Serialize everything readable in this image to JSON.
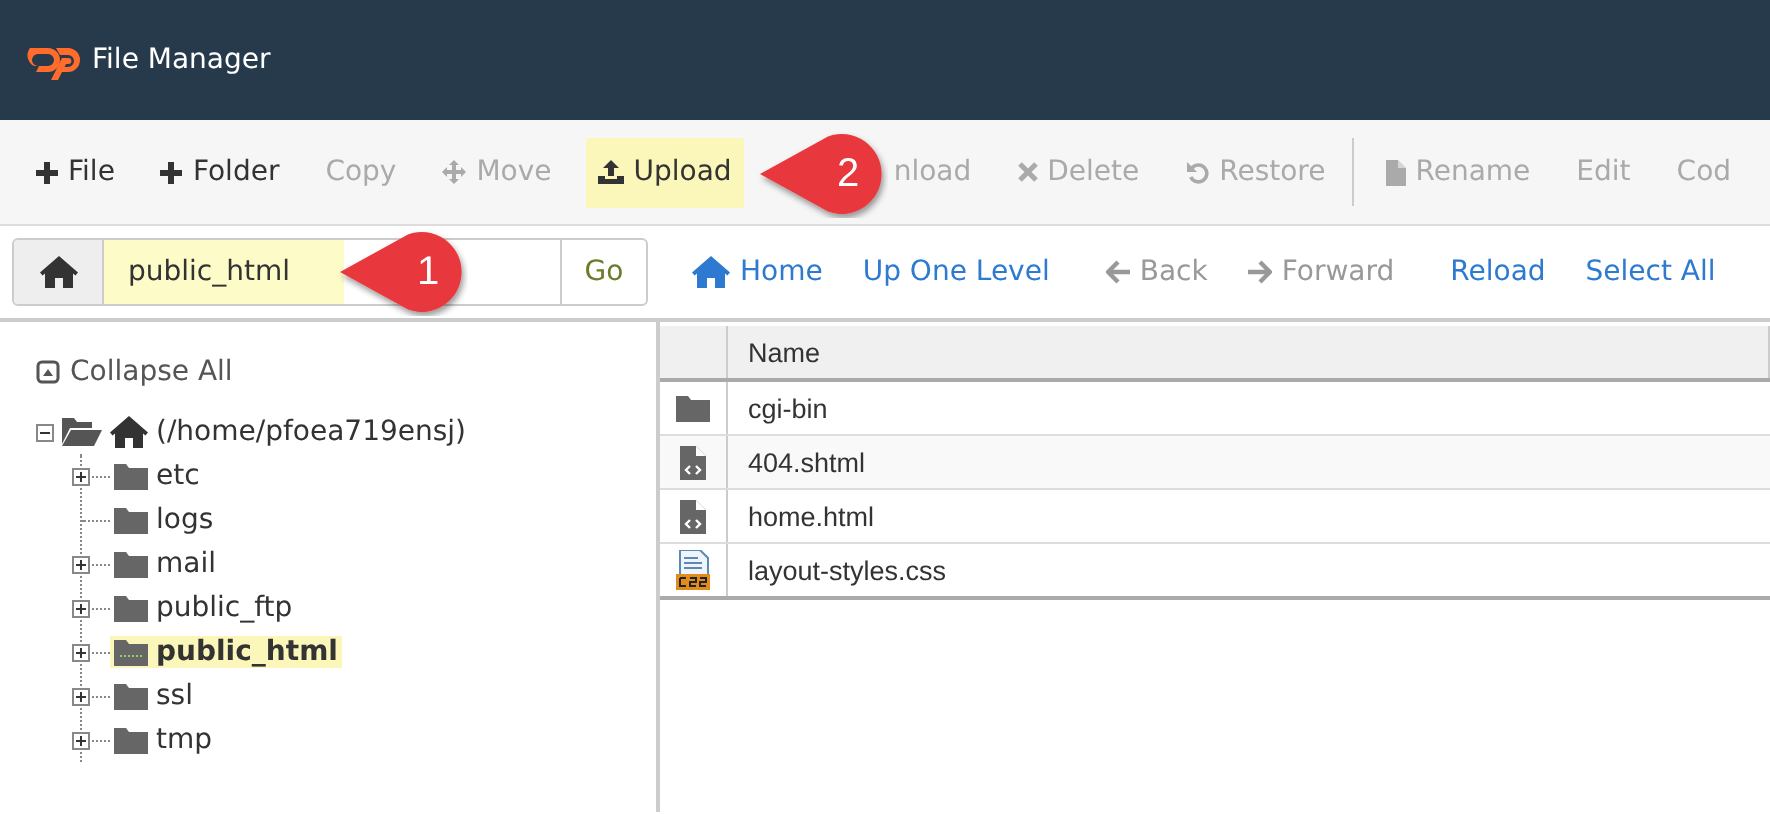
{
  "header": {
    "title": "File Manager"
  },
  "toolbar": [
    {
      "label": "File",
      "kind": "add",
      "disabled": false,
      "highlighted": false
    },
    {
      "label": "Folder",
      "kind": "add",
      "disabled": false,
      "highlighted": false
    },
    {
      "label": "Copy",
      "kind": "plain",
      "disabled": true,
      "highlighted": false
    },
    {
      "label": "Move",
      "kind": "move",
      "disabled": true,
      "highlighted": false
    },
    {
      "label": "Upload",
      "kind": "upload",
      "disabled": false,
      "highlighted": true
    },
    {
      "label": "nload",
      "kind": "plain",
      "disabled": true,
      "highlighted": false
    },
    {
      "label": "Delete",
      "kind": "delete",
      "disabled": true,
      "highlighted": false
    },
    {
      "label": "Restore",
      "kind": "restore",
      "disabled": true,
      "highlighted": false
    },
    {
      "label": "Rename",
      "kind": "rename",
      "disabled": true,
      "highlighted": false
    },
    {
      "label": "Edit",
      "kind": "plain",
      "disabled": true,
      "highlighted": false
    },
    {
      "label": "Cod",
      "kind": "plain",
      "disabled": true,
      "highlighted": false
    }
  ],
  "path_bar": {
    "value": "public_html",
    "button": "Go"
  },
  "nav_links": [
    {
      "label": "Home",
      "kind": "home",
      "disabled": false
    },
    {
      "label": "Up One Level",
      "kind": "plain",
      "disabled": false
    },
    {
      "label": "Back",
      "kind": "back",
      "disabled": true
    },
    {
      "label": "Forward",
      "kind": "forward",
      "disabled": true
    },
    {
      "label": "Reload",
      "kind": "plain",
      "disabled": false
    },
    {
      "label": "Select All",
      "kind": "plain",
      "disabled": false
    }
  ],
  "tree": {
    "collapse_all": "Collapse All",
    "root": {
      "label": "(/home/pfoea719ensj)",
      "expanded": true,
      "children": [
        {
          "label": "etc",
          "expandable": true,
          "selected": false
        },
        {
          "label": "logs",
          "expandable": false,
          "selected": false
        },
        {
          "label": "mail",
          "expandable": true,
          "selected": false
        },
        {
          "label": "public_ftp",
          "expandable": true,
          "selected": false
        },
        {
          "label": "public_html",
          "expandable": true,
          "selected": true
        },
        {
          "label": "ssl",
          "expandable": true,
          "selected": false
        },
        {
          "label": "tmp",
          "expandable": true,
          "selected": false
        }
      ]
    }
  },
  "table": {
    "columns": [
      "Name"
    ],
    "rows": [
      {
        "name": "cgi-bin",
        "kind": "folder"
      },
      {
        "name": "404.shtml",
        "kind": "code"
      },
      {
        "name": "home.html",
        "kind": "code"
      },
      {
        "name": "layout-styles.css",
        "kind": "css"
      }
    ]
  },
  "callouts": [
    {
      "number": "1"
    },
    {
      "number": "2"
    }
  ]
}
